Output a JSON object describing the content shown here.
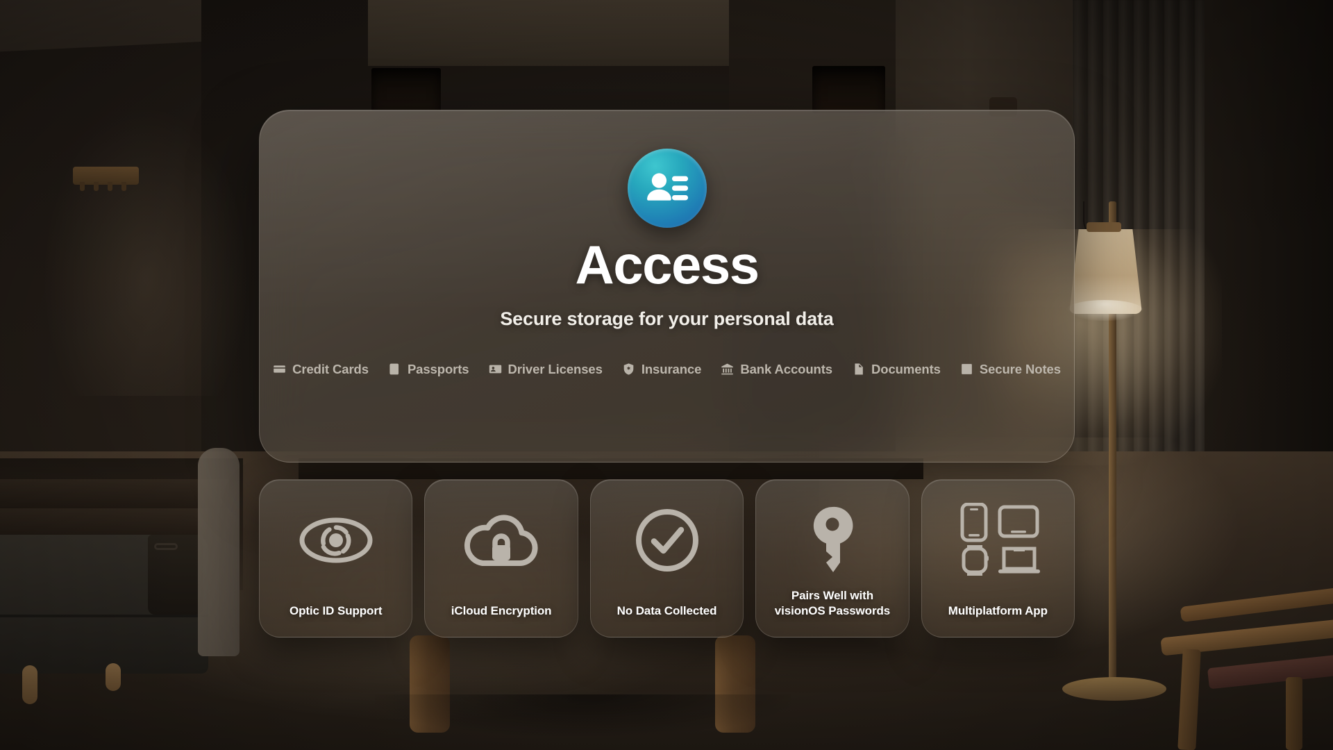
{
  "app": {
    "icon_name": "contact-card-icon",
    "icon_gradient_from": "#3ec6cf",
    "icon_gradient_to": "#1f63ab",
    "title": "Access",
    "subtitle": "Secure storage for your personal data"
  },
  "categories": [
    {
      "label": "Credit Cards",
      "icon": "credit-card-icon"
    },
    {
      "label": "Passports",
      "icon": "passport-book-icon"
    },
    {
      "label": "Driver Licenses",
      "icon": "id-card-icon"
    },
    {
      "label": "Insurance",
      "icon": "shield-cross-icon"
    },
    {
      "label": "Bank Accounts",
      "icon": "bank-building-icon"
    },
    {
      "label": "Documents",
      "icon": "document-icon"
    },
    {
      "label": "Secure Notes",
      "icon": "secure-note-icon"
    }
  ],
  "features": [
    {
      "label": "Optic ID Support",
      "icon": "optic-id-eye-icon"
    },
    {
      "label": "iCloud Encryption",
      "icon": "cloud-lock-icon"
    },
    {
      "label": "No Data Collected",
      "icon": "checkmark-circle-icon"
    },
    {
      "label": "Pairs Well with\nvisionOS Passwords",
      "icon": "key-icon"
    },
    {
      "label": "Multiplatform App",
      "icon": "devices-icon"
    }
  ],
  "theme": {
    "glass_tint": "#605850",
    "text_primary": "#ffffff",
    "text_secondary": "#bdb7ad",
    "icon_grey": "#b9b3aa"
  }
}
